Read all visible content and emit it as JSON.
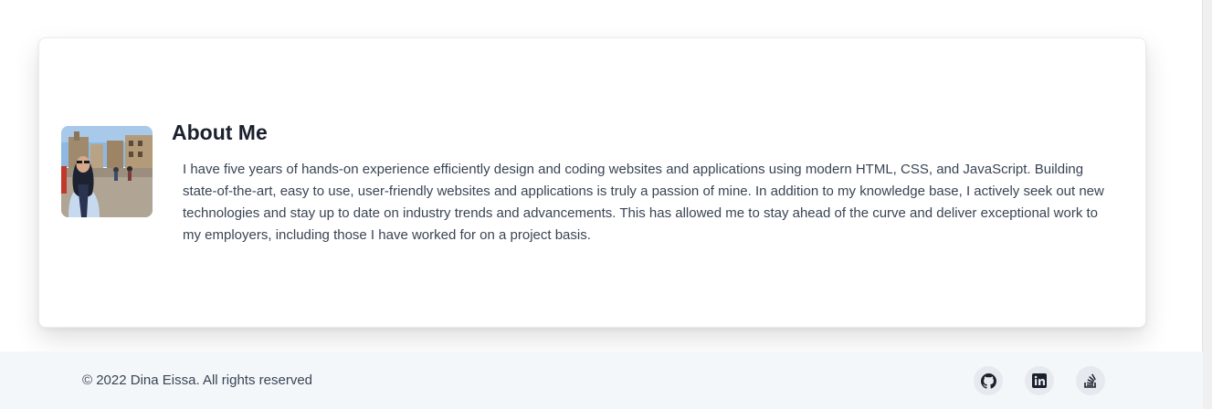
{
  "about": {
    "title": "About Me",
    "photo_alt": "Dina Eissa",
    "paragraph": "I have five years of hands-on experience efficiently design and coding websites and applications using modern HTML, CSS, and JavaScript. Building state-of-the-art, easy to use, user-friendly websites and applications is truly a passion of mine. In addition to my knowledge base, I actively seek out new technologies and stay up to date on industry trends and advancements. This has allowed me to stay ahead of the curve and deliver exceptional work to my employers, including those I have worked for on a project basis."
  },
  "footer": {
    "copyright": "© 2022 Dina Eissa. All rights reserved",
    "social": [
      {
        "icon": "github-icon"
      },
      {
        "icon": "linkedin-icon"
      },
      {
        "icon": "stack-overflow-icon"
      }
    ]
  },
  "colors": {
    "card_bg": "#ffffff",
    "footer_bg": "#f4f7fa",
    "heading": "#1a202c",
    "body_text": "#3a4454",
    "icon_bg": "#e6eaee",
    "icon_fg": "#1a202c"
  }
}
